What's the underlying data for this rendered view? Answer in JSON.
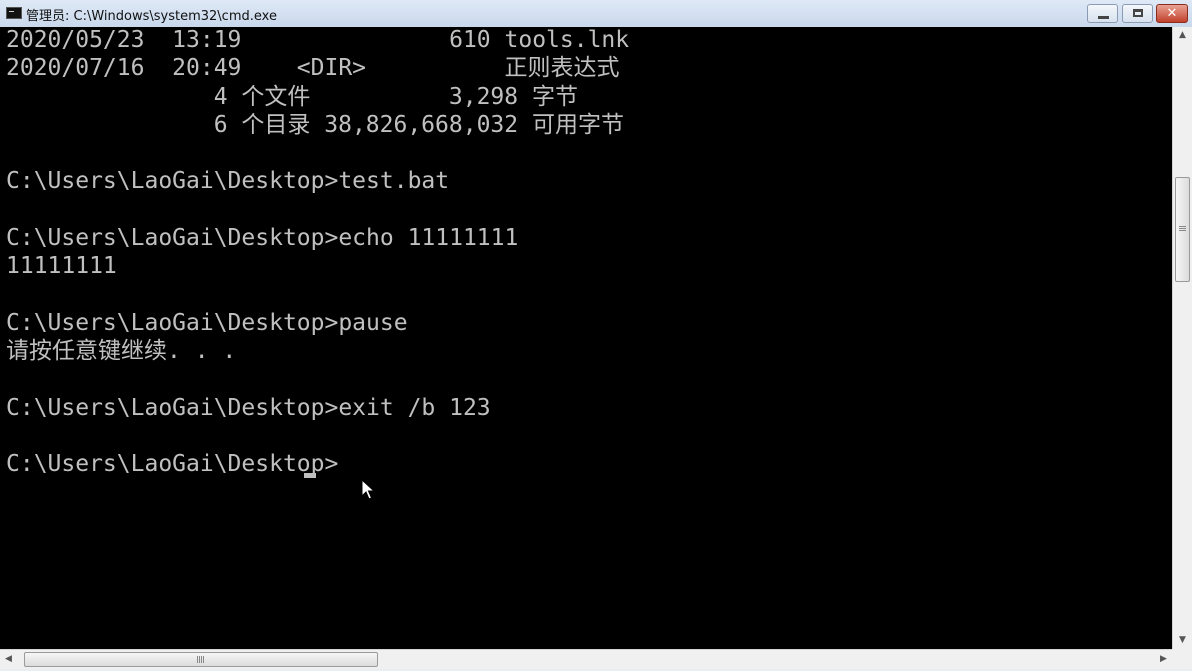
{
  "window": {
    "title": "管理员: C:\\Windows\\system32\\cmd.exe",
    "minimize_glyph": "",
    "maximize_glyph": "",
    "close_glyph": "✕",
    "icon": "console-app-icon"
  },
  "console": {
    "lines": [
      "2020/05/23  13:19               610 tools.lnk",
      "2020/07/16  20:49    <DIR>          正则表达式",
      "               4 个文件          3,298 字节",
      "               6 个目录 38,826,668,032 可用字节",
      "",
      "C:\\Users\\LaoGai\\Desktop>test.bat",
      "",
      "C:\\Users\\LaoGai\\Desktop>echo 11111111",
      "11111111",
      "",
      "C:\\Users\\LaoGai\\Desktop>pause",
      "请按任意键继续. . .",
      "",
      "C:\\Users\\LaoGai\\Desktop>exit /b 123",
      "",
      "C:\\Users\\LaoGai\\Desktop>"
    ]
  },
  "scrollbars": {
    "vertical": {
      "up_arrow": "▲",
      "down_arrow": "▼"
    },
    "horizontal": {
      "left_arrow": "◀",
      "right_arrow": "▶"
    }
  },
  "colors": {
    "console_bg": "#000000",
    "console_fg": "#c0c0c0",
    "close_button": "#c2412c"
  }
}
